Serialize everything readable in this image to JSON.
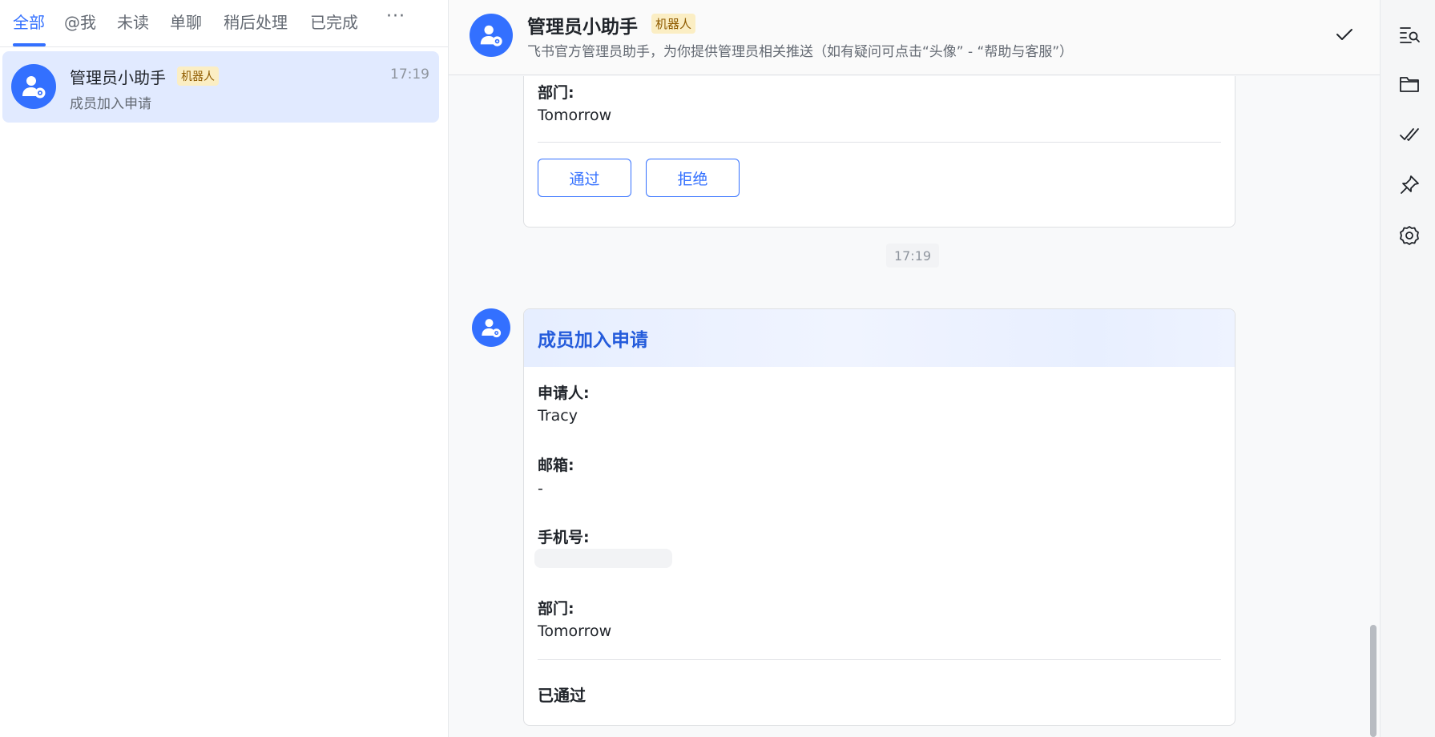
{
  "filter_tabs": [
    {
      "label": "全部",
      "active": true
    },
    {
      "label": "@我"
    },
    {
      "label": "未读"
    },
    {
      "label": "单聊"
    },
    {
      "label": "稍后处理"
    },
    {
      "label": "已完成"
    }
  ],
  "more_tabs_label": "···",
  "chat_list": [
    {
      "name": "管理员小助手",
      "tag": "机器人",
      "time": "17:19",
      "preview": "成员加入申请",
      "selected": true
    }
  ],
  "header": {
    "title": "管理员小助手",
    "tag": "机器人",
    "description": "飞书官方管理员助手，为你提供管理员相关推送（如有疑问可点击“头像” - “帮助与客服”）"
  },
  "card1": {
    "dept_label": "部门:",
    "dept_value": "Tomorrow",
    "approve_label": "通过",
    "reject_label": "拒绝"
  },
  "time_separator": "17:19",
  "card2": {
    "title": "成员加入申请",
    "applicant_label": "申请人:",
    "applicant_value": "Tracy",
    "email_label": "邮箱:",
    "email_value": "-",
    "phone_label": "手机号:",
    "dept_label": "部门:",
    "dept_value": "Tomorrow",
    "status": "已通过"
  },
  "rail_icons": [
    "search-history-icon",
    "folder-icon",
    "task-check-icon",
    "pin-icon",
    "settings-gear-icon"
  ],
  "colors": {
    "accent": "#3370ff",
    "selected_bg": "#e1eaff",
    "tag_bg": "#fbeec4",
    "card_title": "#245bdb"
  }
}
